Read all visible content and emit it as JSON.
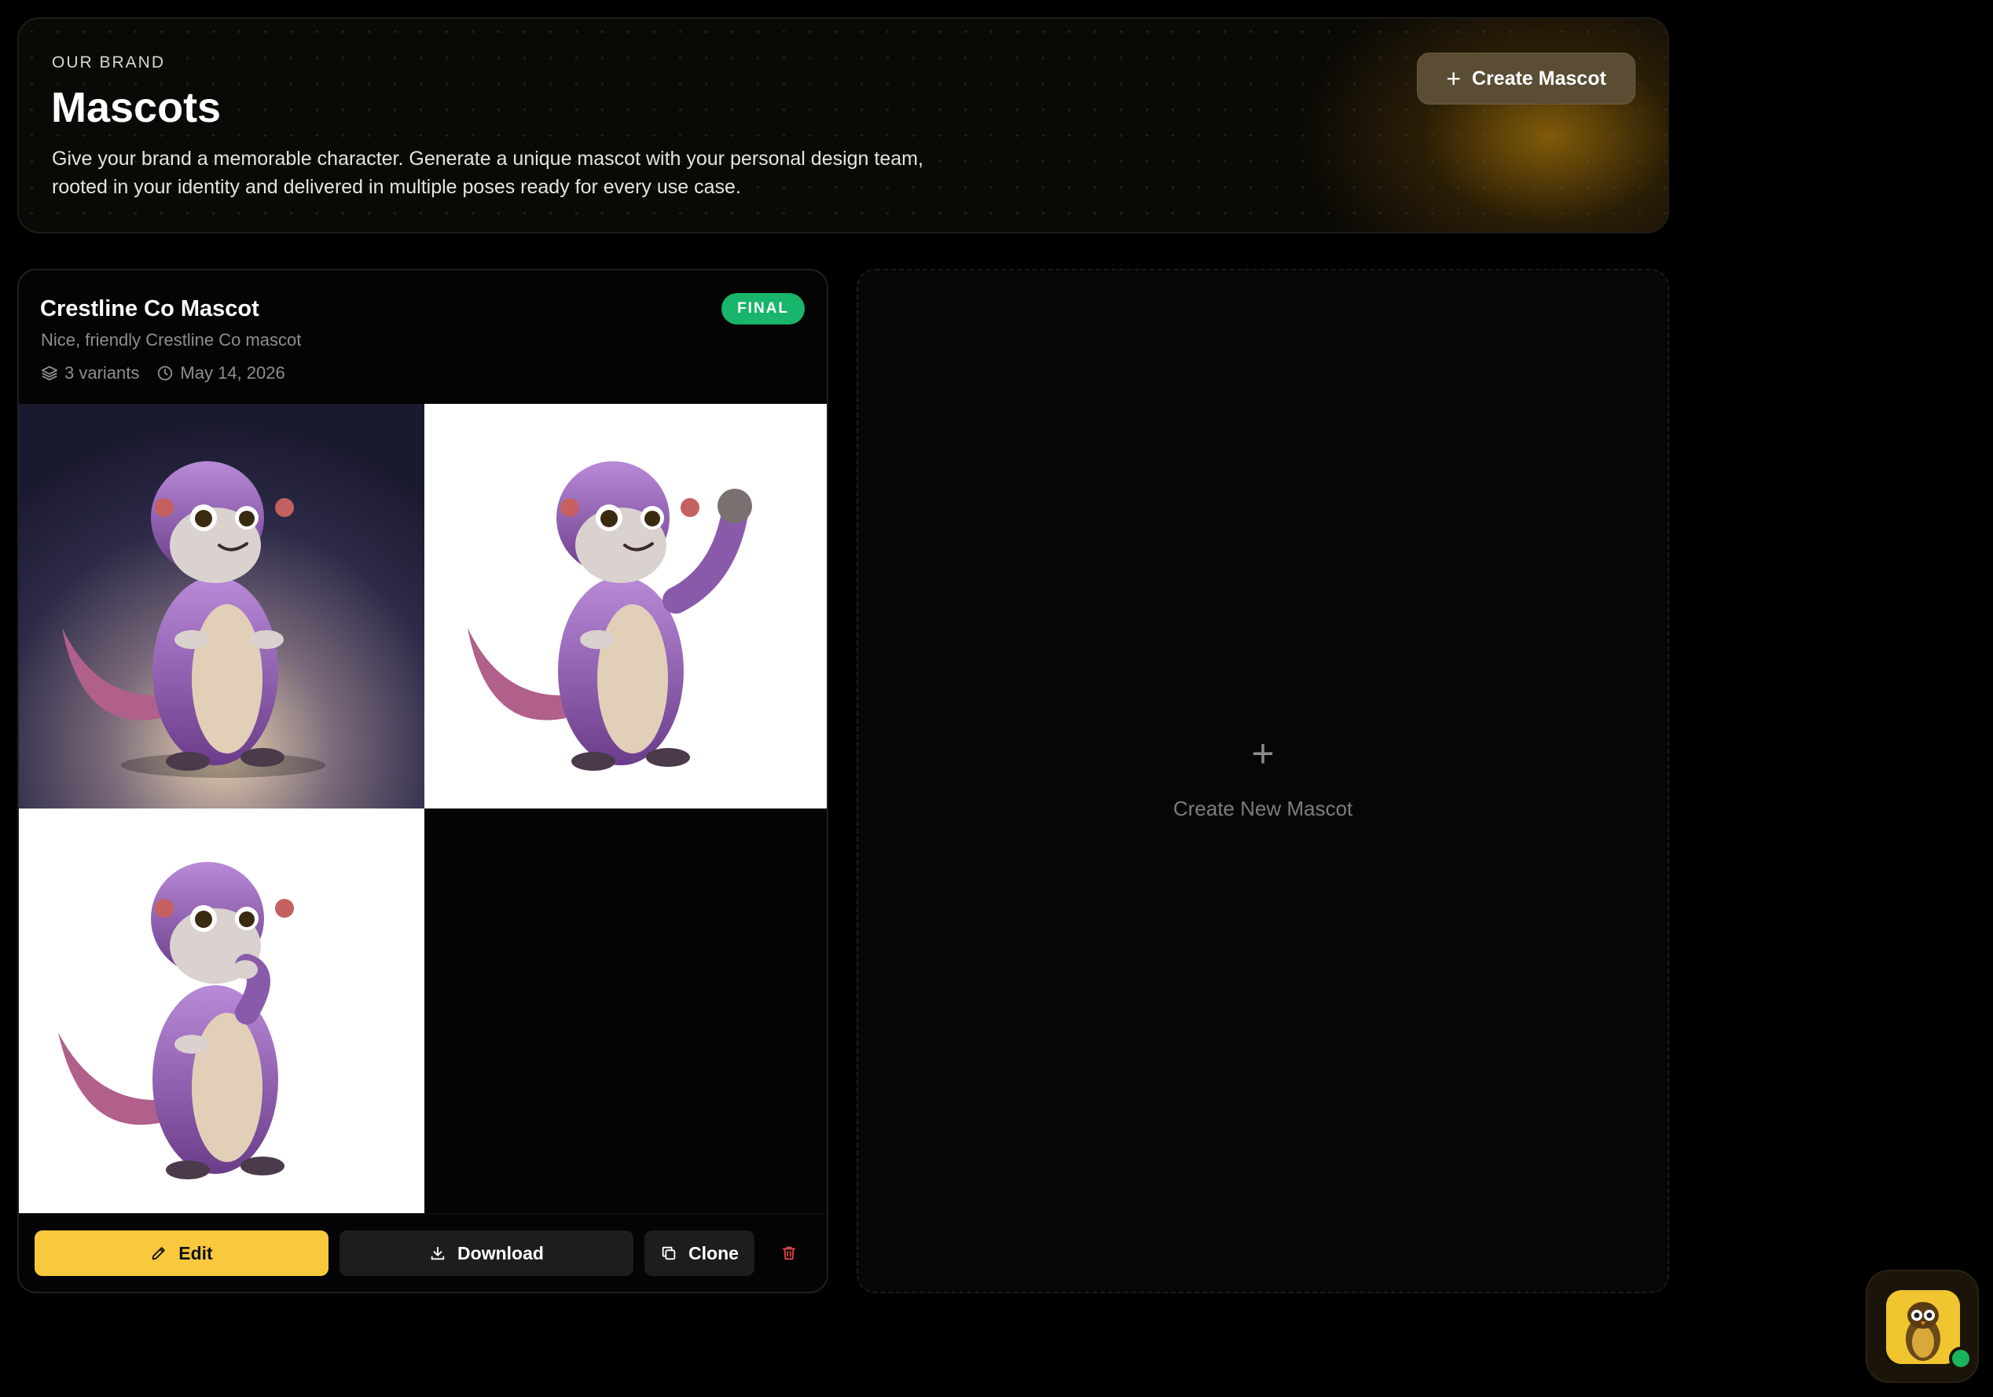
{
  "header": {
    "eyebrow": "OUR BRAND",
    "title": "Mascots",
    "description_line1": "Give your brand a memorable character. Generate a unique mascot with your personal design team,",
    "description_line2": "rooted in your identity and delivered in multiple poses ready for every use case.",
    "create_button_label": "Create Mascot"
  },
  "mascot_card": {
    "title": "Crestline Co Mascot",
    "status_badge": "FINAL",
    "subtitle": "Nice, friendly Crestline Co mascot",
    "variants_label": "3 variants",
    "date_label": "May 14, 2026",
    "images": [
      {
        "icon": "pangolin-mascot-standing-image"
      },
      {
        "icon": "pangolin-mascot-waving-image"
      },
      {
        "icon": "pangolin-mascot-thinking-image"
      }
    ],
    "actions": {
      "edit_label": "Edit",
      "download_label": "Download",
      "clone_label": "Clone"
    }
  },
  "new_panel": {
    "label": "Create New Mascot"
  },
  "colors": {
    "accent_yellow": "#f8c93d",
    "final_green": "#18b56a",
    "delete_red": "#e0434a",
    "online_green": "#1bb35e"
  }
}
